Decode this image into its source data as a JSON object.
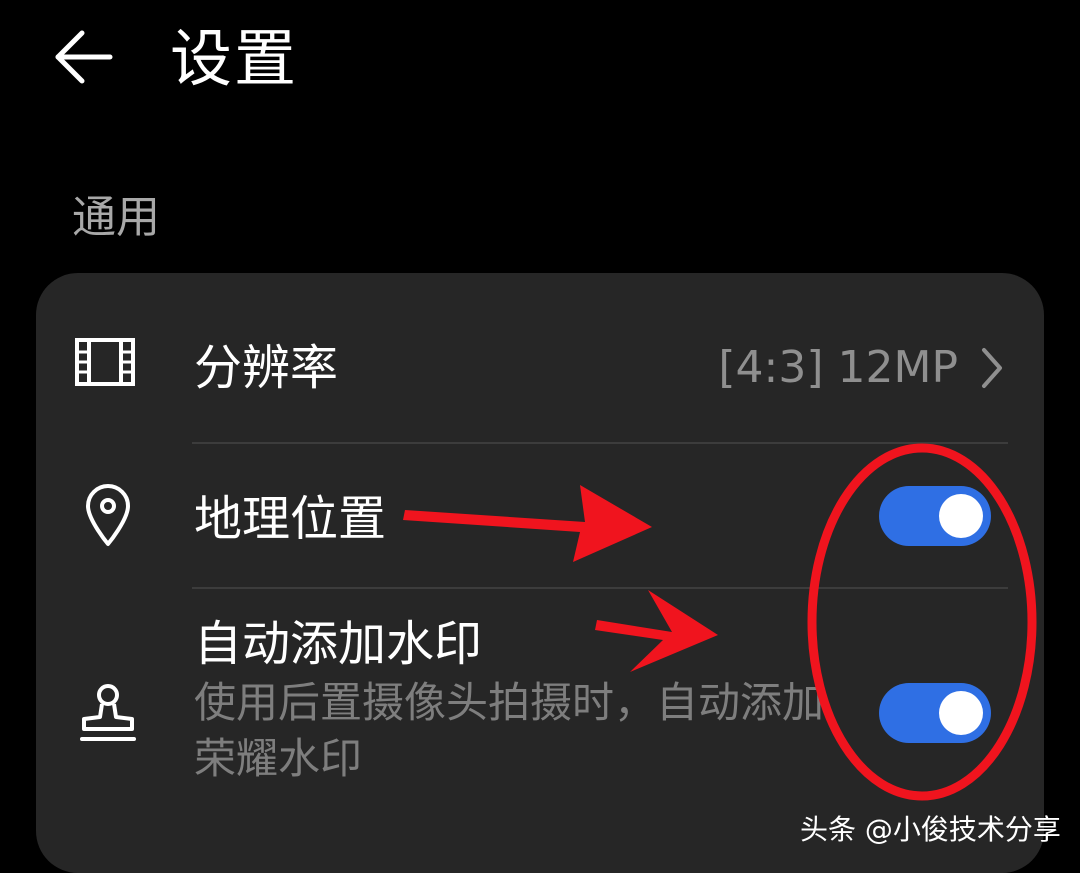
{
  "header": {
    "back_icon": "arrow-left-icon",
    "title": "设置"
  },
  "section": {
    "label": "通用"
  },
  "settings": {
    "resolution": {
      "icon": "film-frame-icon",
      "label": "分辨率",
      "value": "[4:3] 12MP",
      "chevron_icon": "chevron-right-icon"
    },
    "location": {
      "icon": "location-pin-icon",
      "label": "地理位置",
      "enabled": true
    },
    "watermark": {
      "icon": "stamp-icon",
      "label": "自动添加水印",
      "description": "使用后置摄像头拍摄时，自动添加荣耀水印",
      "enabled": true
    }
  },
  "colors": {
    "background": "#000000",
    "card": "#262626",
    "toggle_on": "#2f6fe4",
    "annotation": "#f0141e"
  },
  "annotations": {
    "shapes": [
      "red-arrow",
      "red-arrow",
      "red-ellipse"
    ]
  },
  "watermark_text": "头条 @小俊技术分享"
}
